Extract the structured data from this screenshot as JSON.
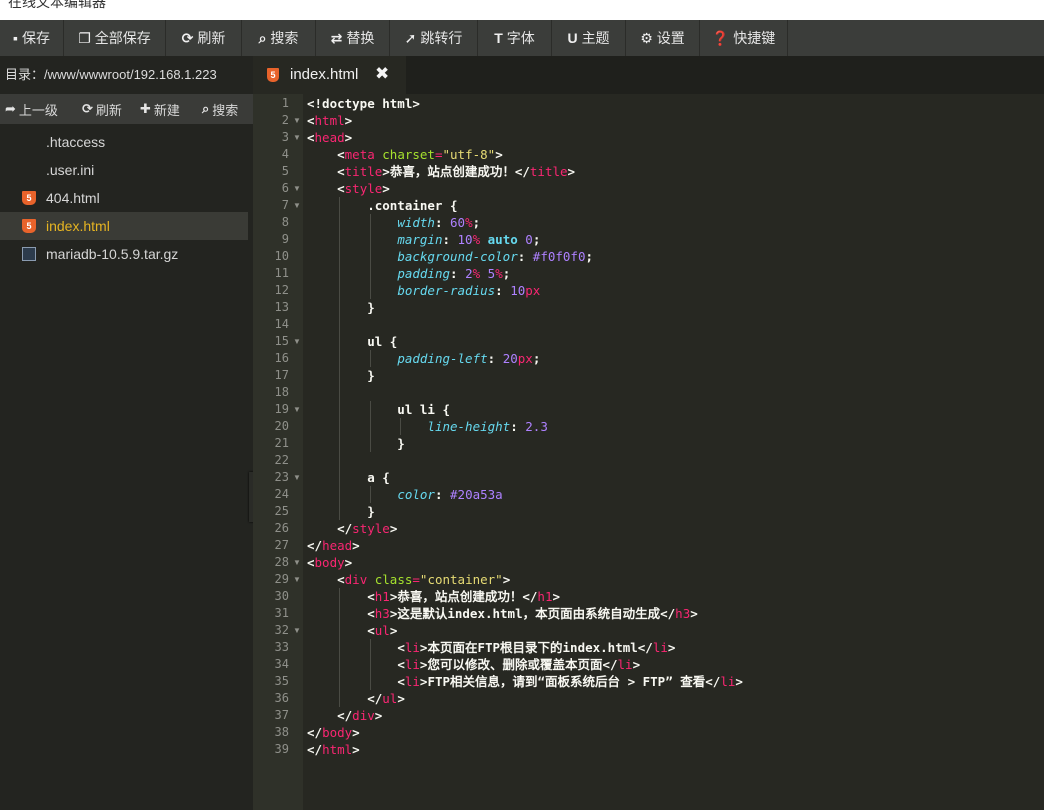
{
  "window": {
    "title": "在线文本编辑器"
  },
  "toolbar": [
    {
      "icon": "save-icon",
      "glyph": "▪",
      "label": "保存",
      "width": 64
    },
    {
      "icon": "save-all-icon",
      "glyph": "❐",
      "label": "全部保存",
      "width": 102
    },
    {
      "icon": "refresh-icon",
      "glyph": "⟳",
      "label": "刷新",
      "width": 76
    },
    {
      "icon": "search-icon",
      "glyph": "⌕",
      "label": "搜索",
      "width": 74
    },
    {
      "icon": "replace-icon",
      "glyph": "⇄",
      "label": "替换",
      "width": 74
    },
    {
      "icon": "goto-line-icon",
      "glyph": "➚",
      "label": "跳转行",
      "width": 88
    },
    {
      "icon": "font-icon",
      "glyph": "T",
      "label": "字体",
      "width": 74
    },
    {
      "icon": "theme-icon",
      "glyph": "U",
      "label": "主题",
      "width": 74
    },
    {
      "icon": "settings-icon",
      "glyph": "⚙",
      "label": "设置",
      "width": 74
    },
    {
      "icon": "help-icon",
      "glyph": "❓",
      "label": "快捷键",
      "width": 88
    }
  ],
  "sidebar": {
    "path": "目录：/www/wwwroot/192.168.1.223",
    "tools": [
      {
        "icon": "up-arrow-icon",
        "glyph": "➦",
        "label": "上一级"
      },
      {
        "icon": "refresh-icon",
        "glyph": "⟳",
        "label": "刷新"
      },
      {
        "icon": "plus-icon",
        "glyph": "✚",
        "label": "新建"
      },
      {
        "icon": "search-icon",
        "glyph": "⌕",
        "label": "搜索"
      }
    ],
    "files": [
      {
        "name": ".htaccess",
        "type": "none"
      },
      {
        "name": ".user.ini",
        "type": "none"
      },
      {
        "name": "404.html",
        "type": "html"
      },
      {
        "name": "index.html",
        "type": "html",
        "active": true
      },
      {
        "name": "mariadb-10.5.9.tar.gz",
        "type": "archive"
      }
    ]
  },
  "tab": {
    "name": "index.html",
    "close": "✖"
  },
  "editor": {
    "lines": [
      "<!doctype html>",
      "<html>",
      "<head>",
      "    <meta charset=\"utf-8\">",
      "    <title>恭喜，站点创建成功！</title>",
      "    <style>",
      "        .container {",
      "            width: 60%;",
      "            margin: 10% auto 0;",
      "            background-color: #f0f0f0;",
      "            padding: 2% 5%;",
      "            border-radius: 10px",
      "        }",
      "",
      "        ul {",
      "            padding-left: 20px;",
      "        }",
      "",
      "            ul li {",
      "                line-height: 2.3",
      "            }",
      "",
      "        a {",
      "            color: #20a53a",
      "        }",
      "    </style>",
      "</head>",
      "<body>",
      "    <div class=\"container\">",
      "        <h1>恭喜，站点创建成功！</h1>",
      "        <h3>这是默认index.html，本页面由系统自动生成</h3>",
      "        <ul>",
      "            <li>本页面在FTP根目录下的index.html</li>",
      "            <li>您可以修改、删除或覆盖本页面</li>",
      "            <li>FTP相关信息，请到“面板系统后台 > FTP” 查看</li>",
      "        </ul>",
      "    </div>",
      "</body>",
      "</html>"
    ],
    "folds": [
      2,
      3,
      6,
      7,
      15,
      19,
      23,
      28,
      29,
      32
    ]
  }
}
